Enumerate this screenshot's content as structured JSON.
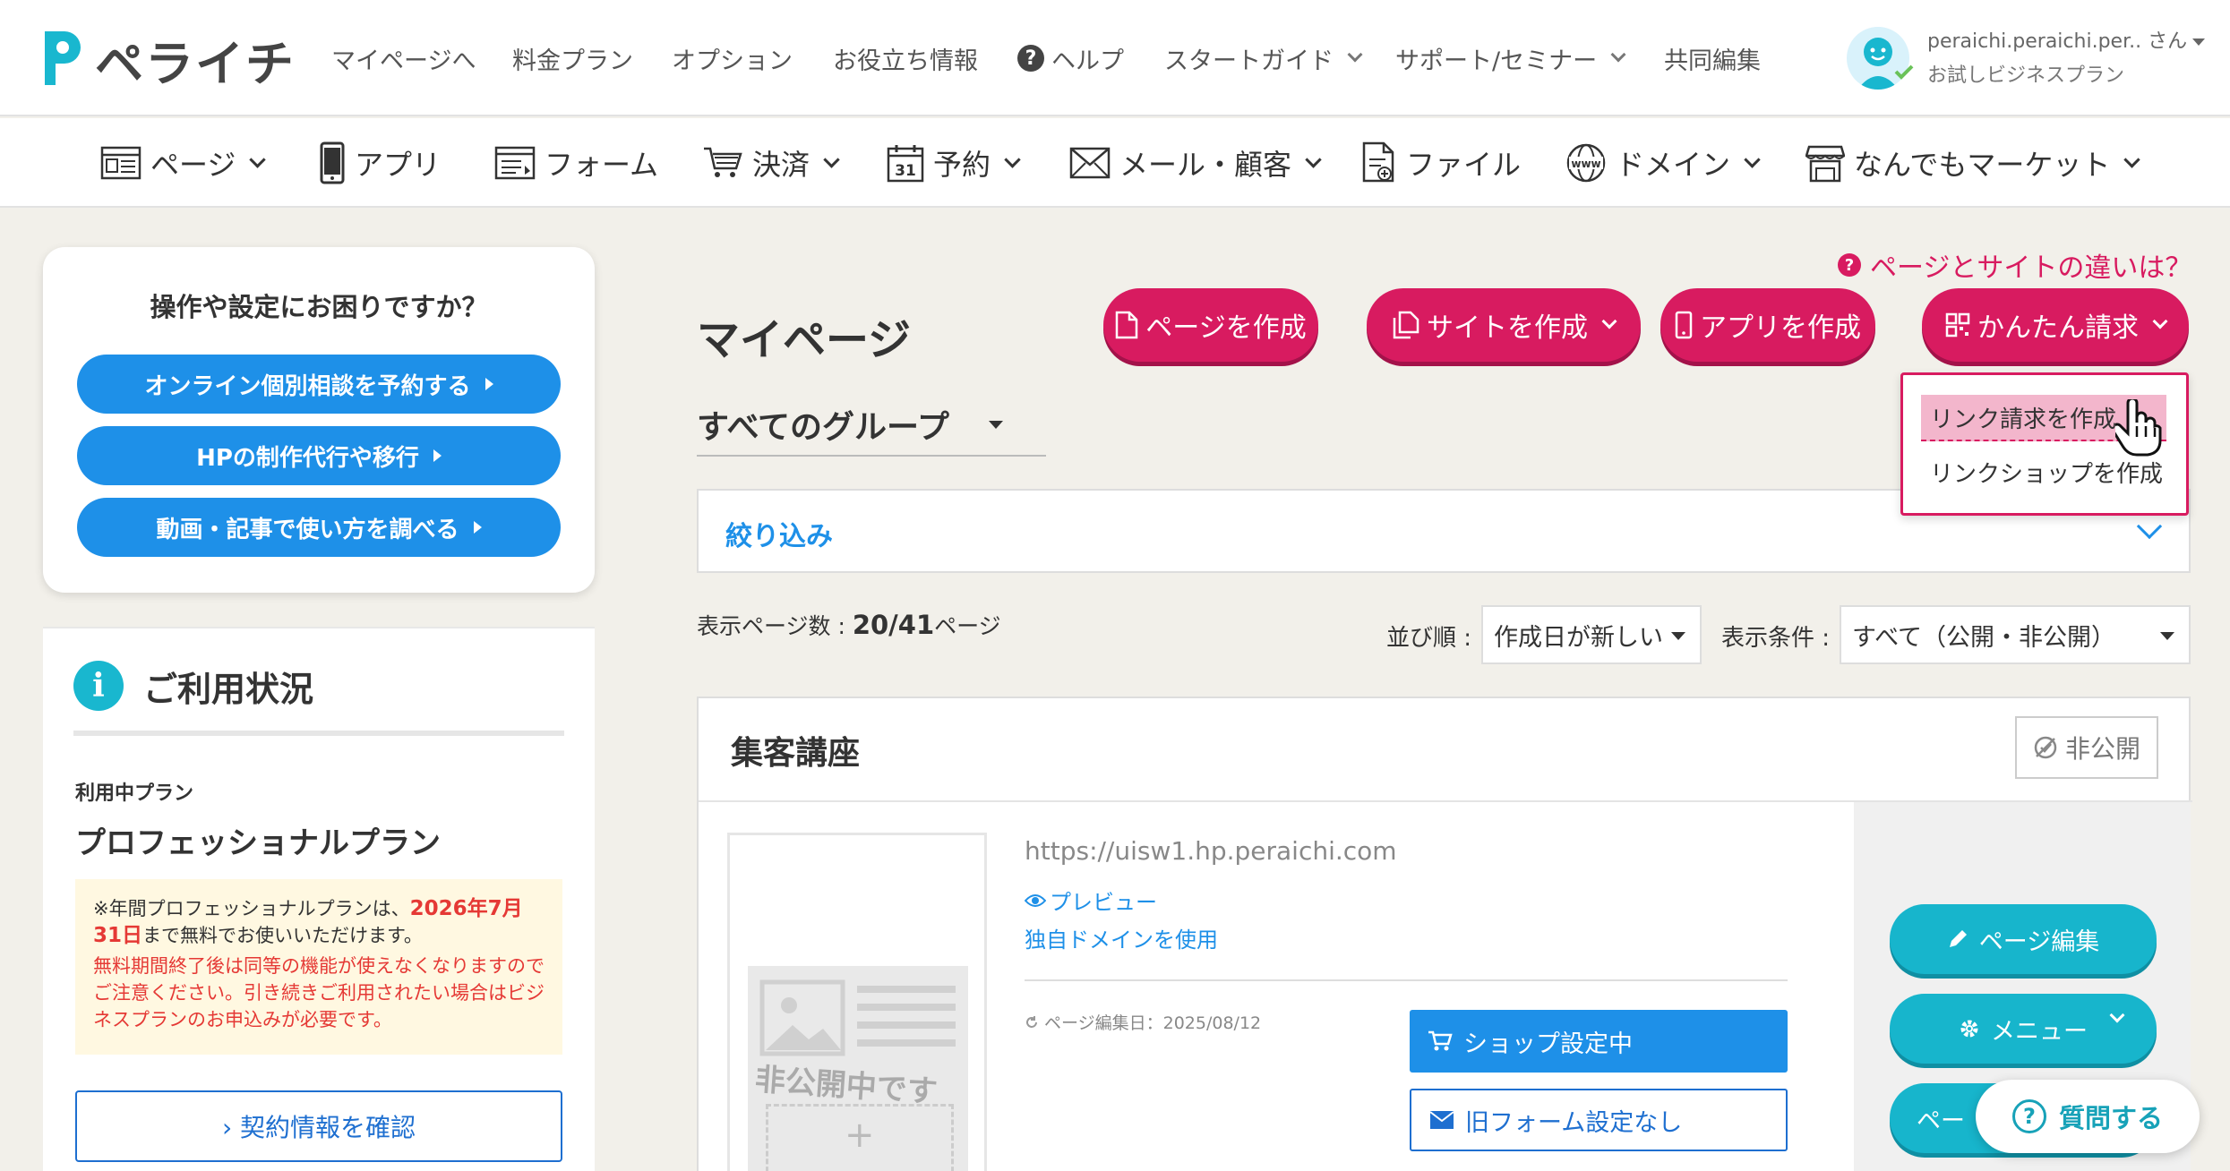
{
  "header": {
    "logo_text": "ペライチ",
    "nav": [
      {
        "label": "マイページへ"
      },
      {
        "label": "料金プラン"
      },
      {
        "label": "オプション"
      },
      {
        "label": "お役立ち情報"
      },
      {
        "label": "ヘルプ"
      },
      {
        "label": "スタートガイド"
      },
      {
        "label": "サポート/セミナー"
      },
      {
        "label": "共同編集"
      }
    ],
    "help_icon_glyph": "?",
    "user": {
      "name": "peraichi.peraichi.per.. さん",
      "plan": "お試しビジネスプラン"
    }
  },
  "menubar": {
    "items": [
      {
        "label": "ページ",
        "icon": "page-icon"
      },
      {
        "label": "アプリ",
        "icon": "smartphone-icon"
      },
      {
        "label": "フォーム",
        "icon": "form-icon"
      },
      {
        "label": "決済",
        "icon": "cart-icon"
      },
      {
        "label": "予約",
        "icon": "calendar-icon"
      },
      {
        "label": "メール・顧客",
        "icon": "mail-icon"
      },
      {
        "label": "ファイル",
        "icon": "file-icon"
      },
      {
        "label": "ドメイン",
        "icon": "globe-icon"
      },
      {
        "label": "なんでもマーケット",
        "icon": "store-icon"
      }
    ],
    "calendar_day": "31",
    "globe_text": "www"
  },
  "help_card": {
    "title": "操作や設定にお困りですか？",
    "buttons": [
      {
        "label": "オンライン個別相談を予約する"
      },
      {
        "label": "HPの制作代行や移行"
      },
      {
        "label": "動画・記事で使い方を調べる"
      }
    ]
  },
  "usage": {
    "icon_glyph": "i",
    "title": "ご利用状況",
    "plan_label": "利用中プラン",
    "plan_name": "プロフェッショナルプラン",
    "notice_prefix": "※年間プロフェッショナルプランは、",
    "notice_date": "2026年7月31日",
    "notice_suffix": "まで無料でお使いいただけます。",
    "notice_warning": "無料期間終了後は同等の機能が使えなくなりますのでご注意ください。引き続きご利用されたい場合はビジネスプランのお申込みが必要です。",
    "contract_button": "› 契約情報を確認"
  },
  "main": {
    "help_link": "ページとサイトの違いは？",
    "help_link_glyph": "?",
    "title": "マイページ",
    "buttons": {
      "create_page": "ページを作成",
      "create_site": "サイトを作成",
      "create_app": "アプリを作成",
      "easy_invoice": "かんたん請求"
    },
    "dropdown": {
      "item1": "リンク請求を作成",
      "item2": "リンクショップを作成"
    },
    "group_select": "すべてのグループ",
    "filter_label": "絞り込み",
    "count_label": "表示ページ数 : ",
    "count_value": "20/41",
    "count_unit": "ページ",
    "sort_label": "並び順 :",
    "sort_value": "作成日が新しい",
    "display_label": "表示条件 :",
    "display_value": "すべて（公開・非公開）"
  },
  "page_card": {
    "title": "集客講座",
    "status_badge": "非公開",
    "thumb_text": "非公開中です",
    "thumb_plus": "+",
    "url": "https://uisw1.hp.peraichi.com",
    "preview_link": "プレビュー",
    "domain_link": "独自ドメインを使用",
    "edit_date": "ページ編集日：2025/08/12",
    "shop_button": "ショップ設定中",
    "form_button": "旧フォーム設定なし",
    "edit_button": "ページ編集",
    "menu_button": "メニュー",
    "third_button_partial": "ペー"
  },
  "question_button": {
    "label": "質問する",
    "glyph": "?"
  },
  "colors": {
    "brand_pink": "#d81b60",
    "brand_blue": "#1e90e8",
    "teal": "#17b5cc",
    "background": "#f2f0ea"
  }
}
